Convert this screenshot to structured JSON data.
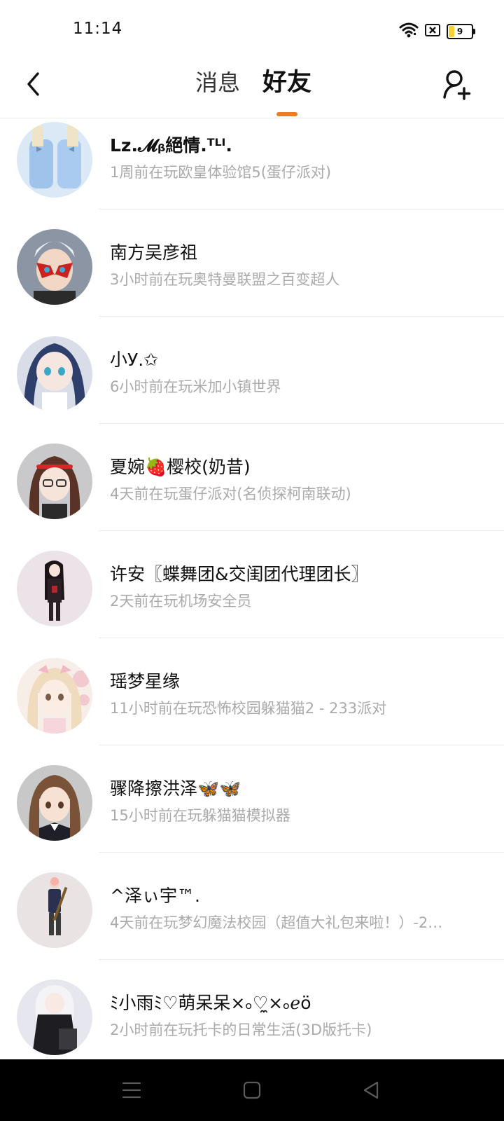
{
  "status_bar": {
    "time": "11:14",
    "battery_level": "9",
    "icons": [
      "wifi-icon",
      "sim-blocked-icon",
      "battery-icon"
    ]
  },
  "header": {
    "tabs": [
      {
        "label": "消息",
        "active": false
      },
      {
        "label": "好友",
        "active": true
      }
    ],
    "accent_color": "#f07a22",
    "back_icon": "back-chevron-icon",
    "add_friend_icon": "add-friend-icon"
  },
  "friends": [
    {
      "name": "Lz.𝓜ᵦ絕情.ᵀᴸᴵ.",
      "status": "1周前在玩欧皇体验馆5(蛋仔派对)",
      "avatar_color": "#b9d5ef"
    },
    {
      "name": "南方吴彦祖",
      "status": "3小时前在玩奥特曼联盟之百变超人",
      "avatar_color": "#c0392b"
    },
    {
      "name": "小У.✩",
      "status": "6小时前在玩米加小镇世界",
      "avatar_color": "#3a4f7a"
    },
    {
      "name": "夏婉🍓樱校(奶昔)",
      "status": "4天前在玩蛋仔派对(名侦探柯南联动)",
      "avatar_color": "#6b3a2a"
    },
    {
      "name": "许安〖蝶舞团&交闺团代理团长〗",
      "status": "2天前在玩机场安全员",
      "avatar_color": "#2a1f2a"
    },
    {
      "name": "瑶梦星缘",
      "status": "11小时前在玩恐怖校园躲猫猫2 - 233派对",
      "avatar_color": "#f1dcc3"
    },
    {
      "name": "骤降擦洪泽🦋🦋",
      "status": "15小时前在玩躲猫猫模拟器",
      "avatar_color": "#7a5238"
    },
    {
      "name": "^泽ぃ宇™.",
      "status": "4天前在玩梦幻魔法校园（超值大礼包来啦！）-2…",
      "avatar_color": "#2a3050"
    },
    {
      "name": "ﾐ小雨ﾐ♡萌呆呆×ₒ♡̼×ₒℯӧ",
      "status": "2小时前在玩托卡的日常生活(3D版托卡)",
      "avatar_color": "#e8e8ee"
    }
  ],
  "nav_bar": {
    "icons": [
      "menu-icon",
      "home-icon",
      "back-icon"
    ]
  }
}
